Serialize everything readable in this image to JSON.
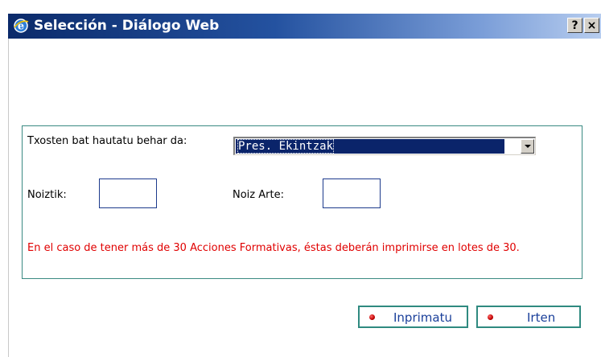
{
  "window": {
    "title": "Selección - Diálogo Web",
    "help_label": "?",
    "close_label": "×"
  },
  "form": {
    "report_label": "Txosten bat hautatu behar da:",
    "report_select": {
      "selected": "Pres. Ekintzak"
    },
    "from_label": "Noiztik:",
    "from_value": "",
    "to_label": "Noiz Arte:",
    "to_value": "",
    "notice": "En el caso de tener más de 30 Acciones Formativas, éstas deberán imprimirse en lotes de 30."
  },
  "buttons": {
    "print_label": "Inprimatu",
    "exit_label": "Irten"
  },
  "colors": {
    "panel_border": "#3a8a82",
    "notice_text": "#e00000",
    "button_text": "#1a3f9a",
    "selection_bg": "#0a246a"
  }
}
